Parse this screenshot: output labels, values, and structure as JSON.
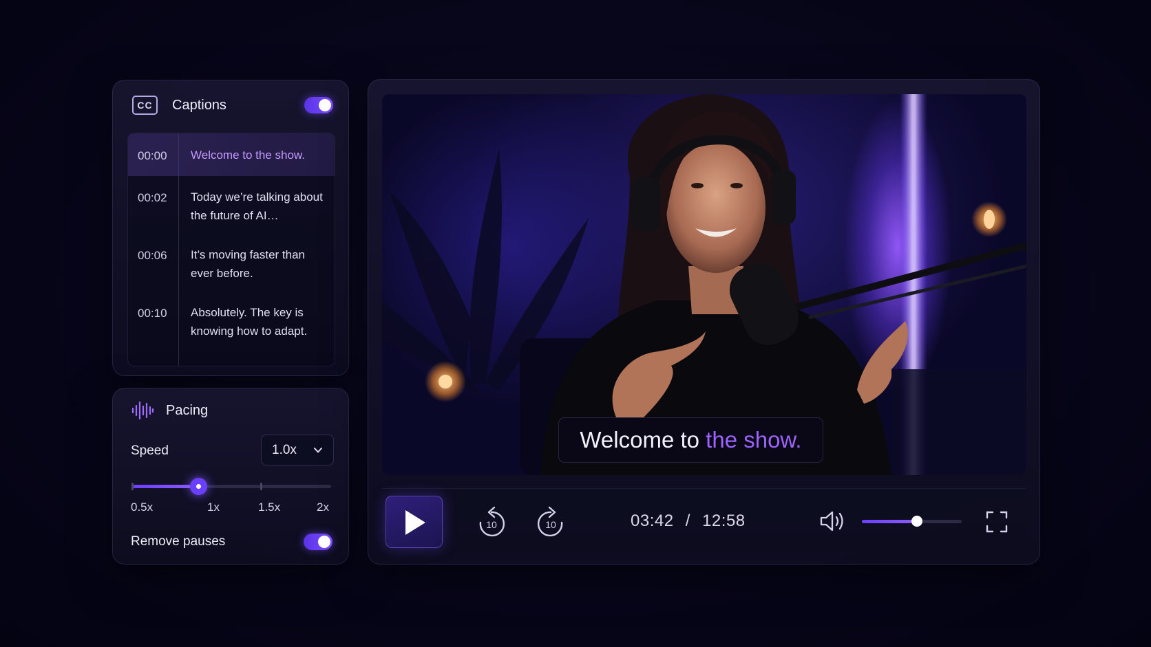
{
  "captions": {
    "title": "Captions",
    "icon_label": "CC",
    "enabled": true,
    "entries": [
      {
        "time": "00:00",
        "text": "Welcome to the show.",
        "active": true
      },
      {
        "time": "00:02",
        "text": "Today we’re talking about the future of AI…",
        "active": false
      },
      {
        "time": "00:06",
        "text": "It’s moving faster than ever before.",
        "active": false
      },
      {
        "time": "00:10",
        "text": "Absolutely. The key is knowing how to adapt.",
        "active": false
      }
    ]
  },
  "pacing": {
    "title": "Pacing",
    "speed_label": "Speed",
    "speed_value": "1.0x",
    "speed_slider": {
      "min": 0.5,
      "max": 2,
      "value": 1.0
    },
    "ticks": [
      "0.5x",
      "1x",
      "1.5x",
      "2x"
    ],
    "remove_pauses_label": "Remove pauses",
    "remove_pauses": true
  },
  "player": {
    "caption_text_plain": "Welcome to",
    "caption_text_highlight": "the show.",
    "skip_back_label": "10",
    "skip_forward_label": "10",
    "current_time": "03:42",
    "time_separator": "/",
    "total_time": "12:58",
    "volume": 0.55,
    "playing": false
  },
  "colors": {
    "accent": "#7b4dff",
    "highlight": "#9d63ff",
    "background": "#07061a"
  }
}
